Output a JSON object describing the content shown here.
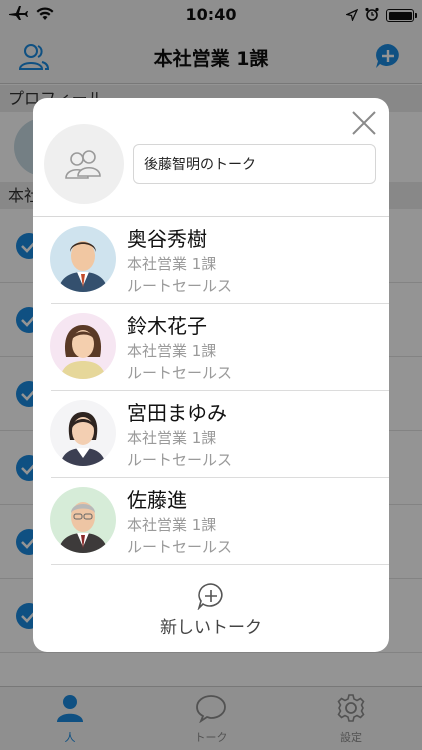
{
  "status_bar": {
    "time": "10:40"
  },
  "nav": {
    "title": "本社営業 1課"
  },
  "background": {
    "section_profile": "プロフィール",
    "section_group": "本社"
  },
  "tabs": [
    {
      "label": "人",
      "icon": "person-icon",
      "active": true
    },
    {
      "label": "トーク",
      "icon": "chat-icon",
      "active": false
    },
    {
      "label": "設定",
      "icon": "gear-icon",
      "active": false
    }
  ],
  "modal": {
    "talk_name": "後藤智明のトーク",
    "members": [
      {
        "name": "奥谷秀樹",
        "dept": "本社営業 1課",
        "role": "ルートセールス",
        "avatar": "man-suit-avatar"
      },
      {
        "name": "鈴木花子",
        "dept": "本社営業 1課",
        "role": "ルートセールス",
        "avatar": "woman-avatar"
      },
      {
        "name": "宮田まゆみ",
        "dept": "本社営業 1課",
        "role": "ルートセールス",
        "avatar": "woman-avatar"
      },
      {
        "name": "佐藤進",
        "dept": "本社営業 1課",
        "role": "ルートセールス",
        "avatar": "older-man-avatar"
      }
    ],
    "new_talk_label": "新しいトーク"
  },
  "colors": {
    "accent": "#1a8be0",
    "overlay": "rgba(0,0,0,0.42)"
  }
}
